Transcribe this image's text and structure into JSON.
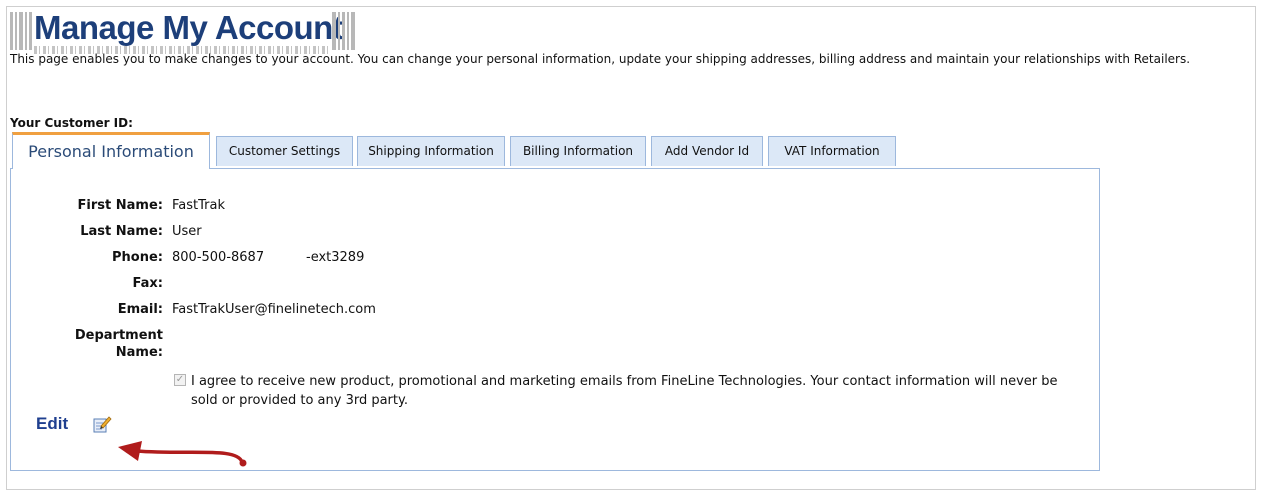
{
  "header": {
    "title": "Manage My Account",
    "intro": "This page enables you to make changes to your account. You can change your personal information, update your shipping addresses, billing address and maintain your relationships with Retailers.",
    "customer_id_label": "Your Customer ID:"
  },
  "tabs": [
    {
      "label": "Personal Information",
      "active": true
    },
    {
      "label": "Customer Settings"
    },
    {
      "label": "Shipping Information"
    },
    {
      "label": "Billing Information"
    },
    {
      "label": "Add Vendor Id"
    },
    {
      "label": "VAT Information"
    }
  ],
  "personal": {
    "first_name_label": "First Name:",
    "first_name": "FastTrak",
    "last_name_label": "Last Name:",
    "last_name": "User",
    "phone_label": "Phone:",
    "phone": "800-500-8687",
    "phone_ext": "-ext3289",
    "fax_label": "Fax:",
    "fax": "",
    "email_label": "Email:",
    "email": "FastTrakUser@finelinetech.com",
    "department_label_line1": "Department",
    "department_label_line2": "Name:",
    "department": "",
    "consent_text": "I agree to receive new product, promotional and marketing emails from FineLine Technologies. Your contact information will never be sold or provided to any 3rd party.",
    "consent_checked": true
  },
  "actions": {
    "edit_label": "Edit"
  },
  "colors": {
    "title": "#1d3f7a",
    "tab_active_accent": "#f0a040",
    "tab_bg": "#dce8f7",
    "border": "#9db8dd",
    "arrow": "#b01c1c"
  },
  "icons": {
    "edit": "edit-document-icon",
    "annotation": "annotation-arrow"
  }
}
